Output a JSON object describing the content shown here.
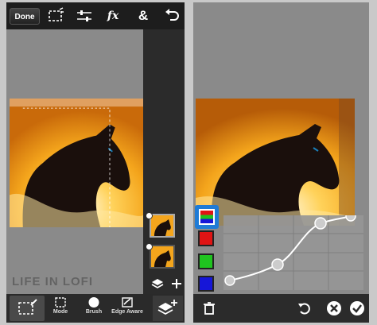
{
  "left_screen": {
    "toolbar": {
      "done_label": "Done",
      "icons": [
        "selection-icon",
        "adjust-sliders-icon",
        "fx-icon",
        "blend-ampersand-icon",
        "undo-icon"
      ],
      "fx_label": "fx",
      "amp_label": "&"
    },
    "layers": {
      "count": 2,
      "selected_index": 0,
      "icons": [
        "layers-stack-icon",
        "add-layer-icon"
      ]
    },
    "bottom_tools": [
      {
        "label": "",
        "icon": "selection-brush-icon",
        "selected": true
      },
      {
        "label": "Mode",
        "icon": "dashed-square-icon"
      },
      {
        "label": "Brush",
        "icon": "circle-brush-icon"
      },
      {
        "label": "Edge Aware",
        "icon": "edge-aware-icon"
      },
      {
        "label": "",
        "icon": "layers-merge-icon"
      }
    ],
    "watermark": "LIFE IN LOFI"
  },
  "right_screen": {
    "channels": [
      {
        "name": "rgb",
        "color": "#3a8f3a",
        "selected": true
      },
      {
        "name": "red",
        "color": "#e01414"
      },
      {
        "name": "green",
        "color": "#1fc41f"
      },
      {
        "name": "blue",
        "color": "#1616d8"
      }
    ],
    "bottom_icons": [
      "trash-icon",
      "reset-icon",
      "cancel-icon",
      "confirm-icon"
    ]
  },
  "colors": {
    "panel_bg": "#8a8a8a",
    "toolbar_bg": "#1d1d1d",
    "accent": "#1f7bd6",
    "photo_glow": "#f4b72c"
  }
}
